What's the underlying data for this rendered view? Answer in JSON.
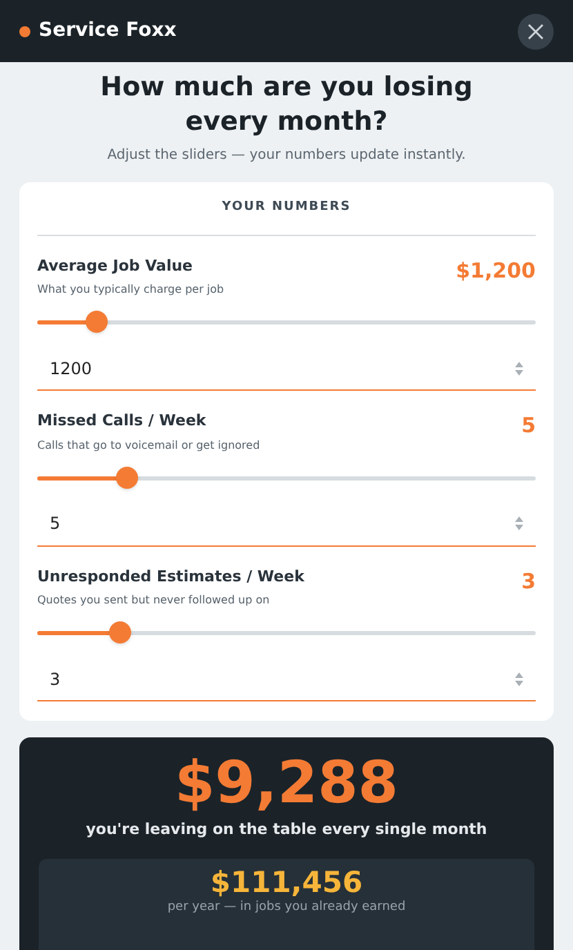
{
  "header": {
    "brand": "Service Foxx"
  },
  "intro": {
    "title": "How much are you losing every month?",
    "subtitle": "Adjust the sliders — your numbers update instantly."
  },
  "inputs_card": {
    "heading": "YOUR NUMBERS",
    "fields": [
      {
        "label": "Average Job Value",
        "hint": "What you typically charge per job",
        "display": "$1,200",
        "level": 0.12,
        "value": "1200"
      },
      {
        "label": "Missed Calls / Week",
        "hint": "Calls that go to voicemail or get ignored",
        "display": "5",
        "level": 0.18,
        "value": "5"
      },
      {
        "label": "Unresponded Estimates / Week",
        "hint": "Quotes you sent but never followed up on",
        "display": "3",
        "level": 0.166,
        "value": "3"
      }
    ]
  },
  "results": {
    "monthly": "$9,288",
    "monthly_caption": "you're leaving on the table every single month",
    "yearly": "$111,456",
    "yearly_caption": "per year — in jobs you already earned"
  }
}
